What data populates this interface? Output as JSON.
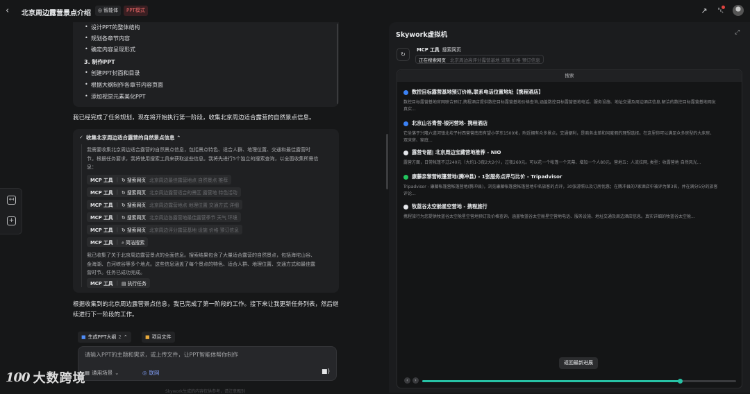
{
  "header": {
    "title": "北京周边露营景点介绍",
    "agent_badge": "智能体",
    "mode_badge": "PPT模式"
  },
  "plan": {
    "items_a": [
      "设计PPT的整体结构",
      "规划各章节内容",
      "确定内容呈现形式"
    ],
    "section3": "3. 制作PPT",
    "items_b": [
      "创建PPT封面和目录",
      "根据大纲制作各章节内容页面",
      "添加视觉元素美化PPT"
    ]
  },
  "msg1": "我已经完成了任务规划，现在将开始执行第一阶段，收集北京周边适合露营的自然景点信息。",
  "task": {
    "title": "收集北京周边适合露营的自然景点信息",
    "intro": [
      "我需要收集北京周边适合露营的自然景点信息，包括景点特色、适合人群、地理位置、交通和最佳露营时",
      "节。根据任务要求，我将使用搜索工具来获取这些信息。我将先进行5个独立的搜索查询，以全面收集所需信",
      "息："
    ],
    "tools": [
      {
        "label": "MCP 工具",
        "action": "搜索网页",
        "query": "北京周边最佳露营地点 自然景点 推荐"
      },
      {
        "label": "MCP 工具",
        "action": "搜索网页",
        "query": "北京周边露营适合的景区 露营地 特色活动"
      },
      {
        "label": "MCP 工具",
        "action": "搜索网页",
        "query": "北京周边露营地点 地理位置 交通方式 详细"
      },
      {
        "label": "MCP 工具",
        "action": "搜索网页",
        "query": "北京周边各露营地最佳露营季节 天气 环境"
      },
      {
        "label": "MCP 工具",
        "action": "搜索网页",
        "query": "北京周边评分露营基地 设施 价格 预订信息"
      },
      {
        "label": "MCP 工具",
        "action": "简洁搜索",
        "query": ""
      }
    ],
    "summary": [
      "我已收集了关于北京周边露营景点的全面信息。搜索结果包含了大量适合露营的自然景点，包括海坨山谷、",
      "金海湖、白河峡谷等多个地点。这些信息涵盖了每个景点的特色、适合人群、地理位置、交通方式和最佳露",
      "营时节。任务已成功完成。"
    ],
    "final_tool": {
      "label": "MCP 工具",
      "action": "执行任务"
    }
  },
  "msg2": [
    "根据收集到的北京周边露营景点信息，我已完成了第一阶段的工作。接下来让我更新任务列表，然后继",
    "续进行下一阶段的工作。"
  ],
  "dock": {
    "tab1": "生成PPT大纲",
    "tab1_count": "2",
    "tab2": "项目文件",
    "placeholder": "请输入PPT的主题和需求，或上传文件，让PPT智能体帮你制作",
    "scene": "通用场景",
    "web": "联网",
    "footnote": "Skywork生成的内容仅供参考，请注意甄别"
  },
  "watermark": {
    "logo": "100",
    "text": "大数跨境"
  },
  "vm": {
    "title": "Skywork虚拟机",
    "mcp_label": "MCP 工具",
    "mcp_action": "搜索网页",
    "status": "正在搜索网页",
    "status_query": "北京周边高评分露营基地 设施 价格 预订信息",
    "browser_title": "搜索",
    "results": [
      {
        "title": "数控目标露营基地预订价格,联系电话位置地址【携程酒店】",
        "color": "#3b82f6",
        "desc": [
          "数控目标露营基地官网联合预订,携程酒店提供数控目标露营基地价格查询,涵盖数控目标露营基地电话、服务设施、地址交通及周边酒店信息,解洽的数控目标露营基地网友",
          "真实..."
        ]
      },
      {
        "title": "北京山谷青营-银河营地- 携程酒店",
        "color": "#3b82f6",
        "desc": [
          "它坐落于兴隆六道河镇北坎子村西营营南南有望小学东1500米，附近拥有众多景点，交通便利，是商务出差和闲度假的理想选择。在这里你可以满足众多房型的大床房、",
          "双床房、家庭..."
        ]
      },
      {
        "title": "露营专题| 北京周边宝藏营地推荐 - NIO",
        "color": "#e5e7eb",
        "desc": [
          "露营方面，日常帐篷不过240元（大约1-3夜2大2小），过夜260元。可以花一个帐篷一个天幕、增加一个人80元。营地五：人流拉网, 类型：收露营地 自然风光..."
        ]
      },
      {
        "title": "康藤亲黎营帐篷营地(腾冲县) - 1张服务点评与比价 - Tripadvisor",
        "color": "#22c55e",
        "desc": [
          "Tripadvisor - 康藤帐篷营帐篷营地(腾冲县)，浏览康藤帐篷营帐篷营地中名旅客的点评，30张游照以及订房优惠；在腾冲县的7家酒店中被评为第3名，并在满分5分的旅客",
          "评论..."
        ]
      },
      {
        "title": "牧蓝谷太空舱星空营地 - 携程旅行",
        "color": "#e5e7eb",
        "desc": [
          "携程旅行为您提供牧蓝谷太空舱星空营地预订及价格查询，涵盖牧蓝谷太空舱星空营地电话、服务设施、地址交通及周边酒店信息。真实详细的牧蓝谷太空舱..."
        ]
      }
    ],
    "return_btn": "返回最新进展",
    "progress": 0.82
  },
  "colors": {
    "accent": "#27c2a5",
    "ppt_badge": "#f06a6a",
    "notif": "#e0433f"
  }
}
